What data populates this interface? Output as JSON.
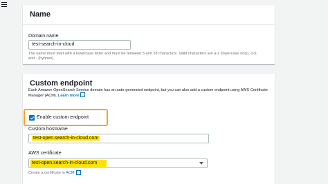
{
  "icons": {
    "menu": "hamburger-menu-icon",
    "external": "external-link-icon",
    "caret": "caret-down-icon"
  },
  "colors": {
    "highlight": "#ffe100",
    "callout": "#f5a623",
    "link": "#0073bb"
  },
  "name_section": {
    "title": "Name",
    "domain_label": "Domain name",
    "domain_value": "test-search-in-cloud",
    "hint": "The name must start with a lowercase letter and must be between 3 and 28 characters. Valid characters are a-z (lowercase only), 0-9, and - (hyphen)."
  },
  "endpoint_section": {
    "title": "Custom endpoint",
    "description": "Each Amazon OpenSearch Service domain has an auto-generated endpoint, but you can also add a custom endpoint using AWS Certificate Manager (ACM).",
    "learn_more": "Learn more",
    "enable_label": "Enable custom endpoint",
    "enable_checked": true,
    "hostname_label": "Custom hostname",
    "hostname_value": "test-open.search-in-cloud.com",
    "certificate_label": "AWS certificate",
    "certificate_value": "test-open.search-in-cloud.com",
    "create_cert_prefix": "Create a certificate in",
    "create_cert_link": "ACM"
  }
}
